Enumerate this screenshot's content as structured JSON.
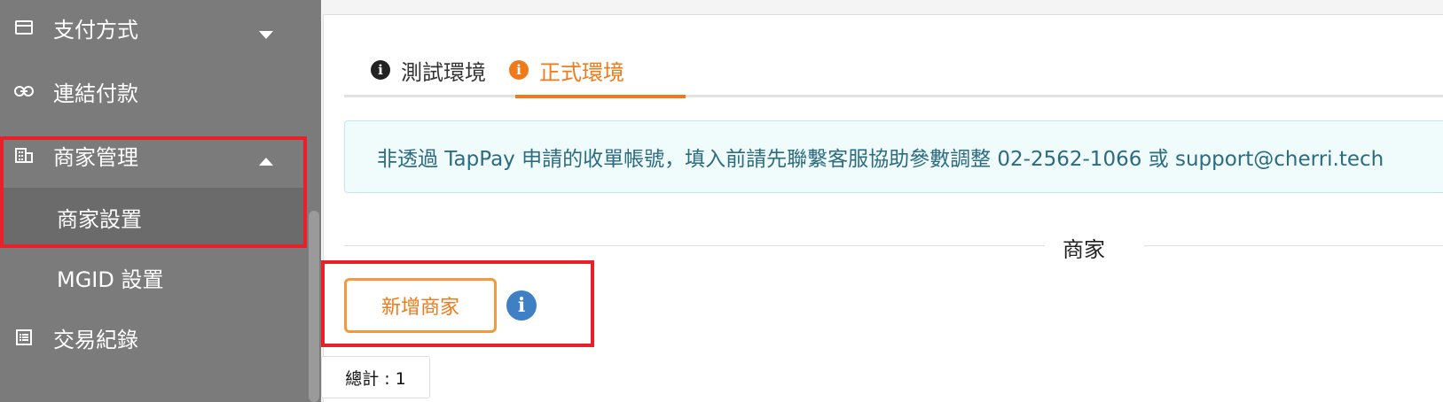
{
  "sidebar": {
    "items": [
      {
        "label": "支付方式",
        "icon": "credit-card-icon"
      },
      {
        "label": "連結付款",
        "icon": "link-icon"
      },
      {
        "label": "商家管理",
        "icon": "building-icon"
      },
      {
        "label": "交易紀錄",
        "icon": "list-icon"
      }
    ],
    "subitems": [
      {
        "label": "商家設置"
      },
      {
        "label": "MGID 設置"
      }
    ]
  },
  "tabs": [
    {
      "label": "測試環境",
      "icon": "info-icon"
    },
    {
      "label": "正式環境",
      "icon": "info-icon"
    }
  ],
  "alert": {
    "text": "非透過 TapPay 申請的收單帳號，填入前請先聯繫客服協助參數調整 02-2562-1066 或 support@cherri.tech"
  },
  "section": {
    "title": "商家"
  },
  "actions": {
    "add_merchant_label": "新增商家",
    "info_icon_glyph": "i"
  },
  "footer": {
    "total_label": "總計 : 1"
  },
  "colors": {
    "accent": "#f07a1a",
    "highlight": "#e8202a",
    "sidebar_bg": "#7b7b7b",
    "info_blue": "#3f7fc4"
  }
}
